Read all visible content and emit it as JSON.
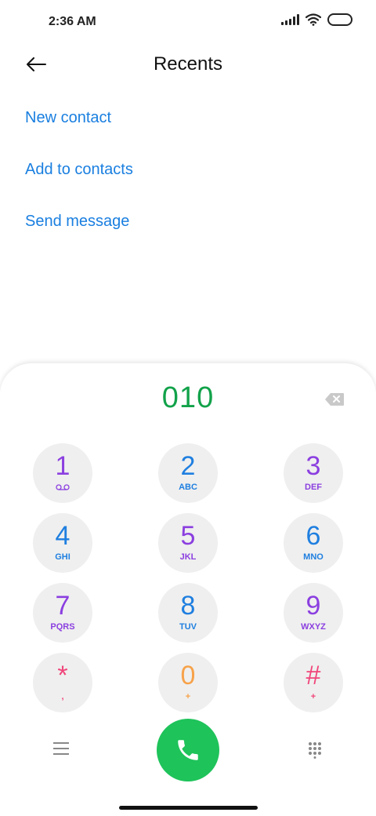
{
  "status_bar": {
    "time": "2:36 AM"
  },
  "header": {
    "title": "Recents"
  },
  "menu": {
    "items": [
      {
        "label": "New contact"
      },
      {
        "label": "Add to contacts"
      },
      {
        "label": "Send message"
      }
    ]
  },
  "dialer": {
    "number": "010",
    "keys": [
      {
        "digit": "1",
        "letters": "",
        "color": "#8b3fe0"
      },
      {
        "digit": "2",
        "letters": "ABC",
        "color": "#1f7fe0"
      },
      {
        "digit": "3",
        "letters": "DEF",
        "color": "#8b3fe0"
      },
      {
        "digit": "4",
        "letters": "GHI",
        "color": "#1f7fe0"
      },
      {
        "digit": "5",
        "letters": "JKL",
        "color": "#8b3fe0"
      },
      {
        "digit": "6",
        "letters": "MNO",
        "color": "#1f7fe0"
      },
      {
        "digit": "7",
        "letters": "PQRS",
        "color": "#8b3fe0"
      },
      {
        "digit": "8",
        "letters": "TUV",
        "color": "#1f7fe0"
      },
      {
        "digit": "9",
        "letters": "WXYZ",
        "color": "#8b3fe0"
      },
      {
        "digit": "*",
        "letters": ",",
        "color": "#f0457a"
      },
      {
        "digit": "0",
        "letters": "+",
        "color": "#f7a24a"
      },
      {
        "digit": "#",
        "letters": "+",
        "color": "#f0457a"
      }
    ]
  },
  "colors": {
    "accent_blue": "#1a7fe0",
    "number_green": "#12a24a",
    "call_green": "#1ec35a",
    "key_bg": "#efefef"
  },
  "icons": {
    "back": "arrow-left-icon",
    "backspace": "backspace-icon",
    "voicemail": "voicemail-icon",
    "menu": "hamburger-menu-icon",
    "call": "phone-icon",
    "keypad": "dialpad-icon"
  }
}
